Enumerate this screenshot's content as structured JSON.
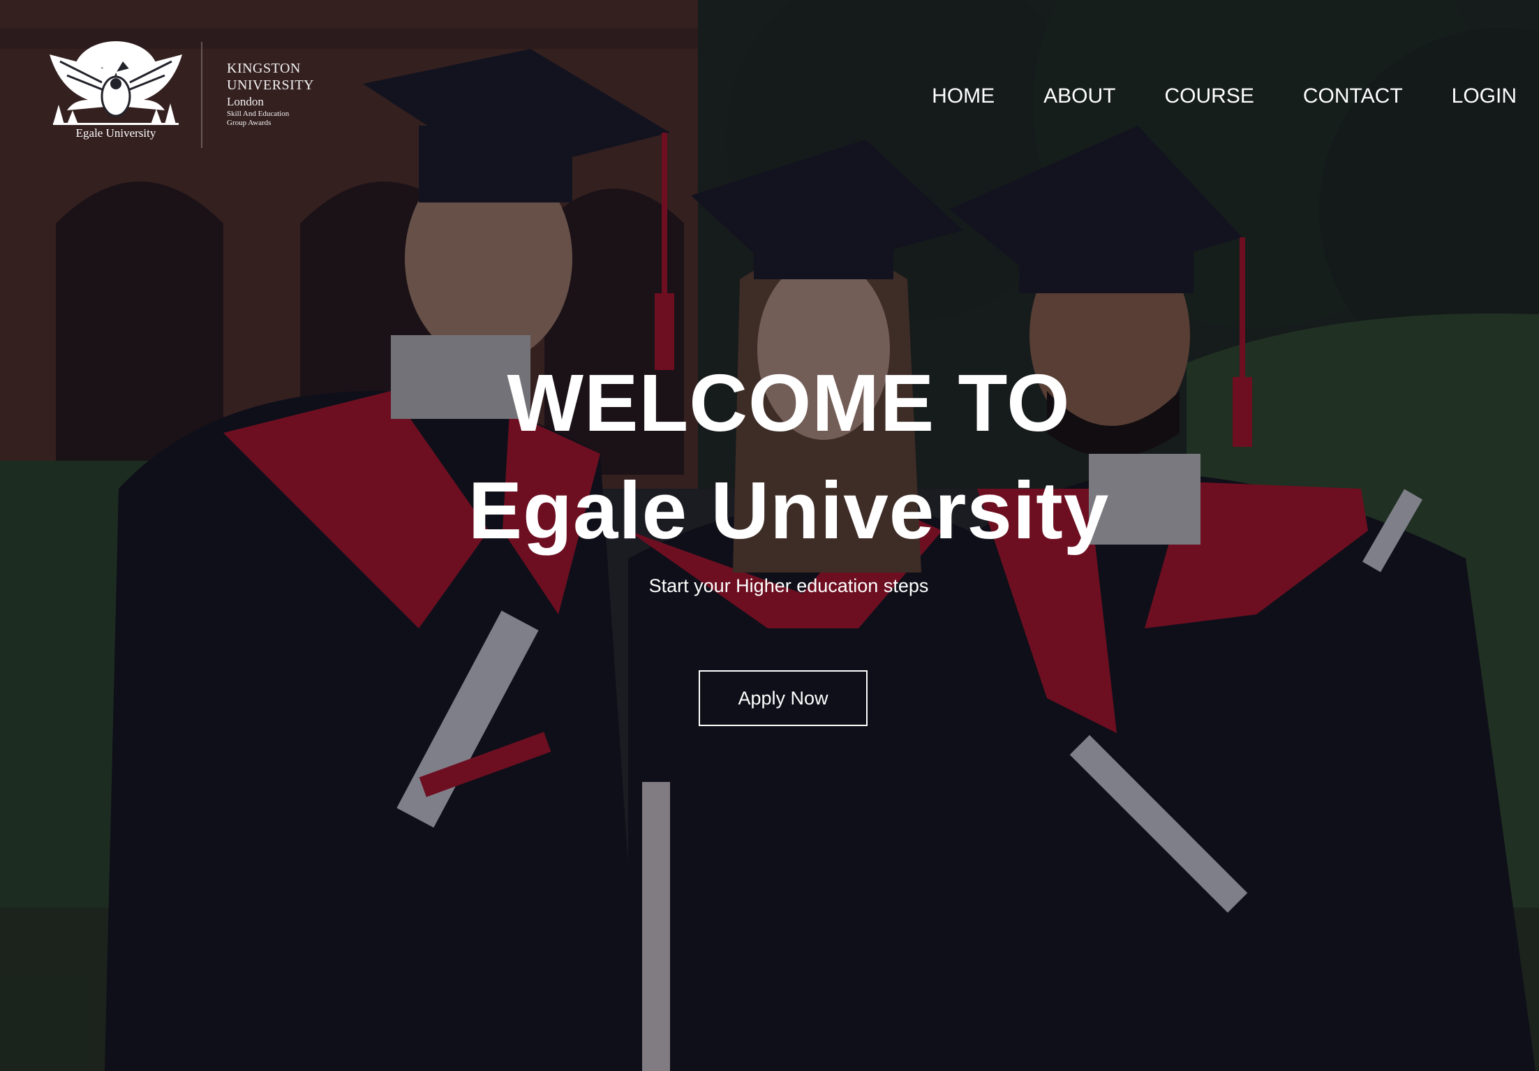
{
  "brand": {
    "logo_caption": "Egale University",
    "org_line1": "KINGSTON",
    "org_line2": "UNIVERSITY",
    "org_line3": "London",
    "org_line4": "Skill And Education",
    "org_line5": "Group Awards"
  },
  "nav": {
    "items": [
      {
        "label": "HOME"
      },
      {
        "label": "ABOUT"
      },
      {
        "label": "COURSE"
      },
      {
        "label": "CONTACT"
      },
      {
        "label": "LOGIN"
      }
    ]
  },
  "hero": {
    "title_line1": "WELCOME TO",
    "title_line2": "Egale University",
    "subtitle": "Start your Higher education steps",
    "cta_label": "Apply Now"
  },
  "colors": {
    "gown": "#14141c",
    "sash": "#c0152b",
    "hedge": "#2f4a2a",
    "brick": "#5a3428",
    "text": "#ffffff"
  }
}
